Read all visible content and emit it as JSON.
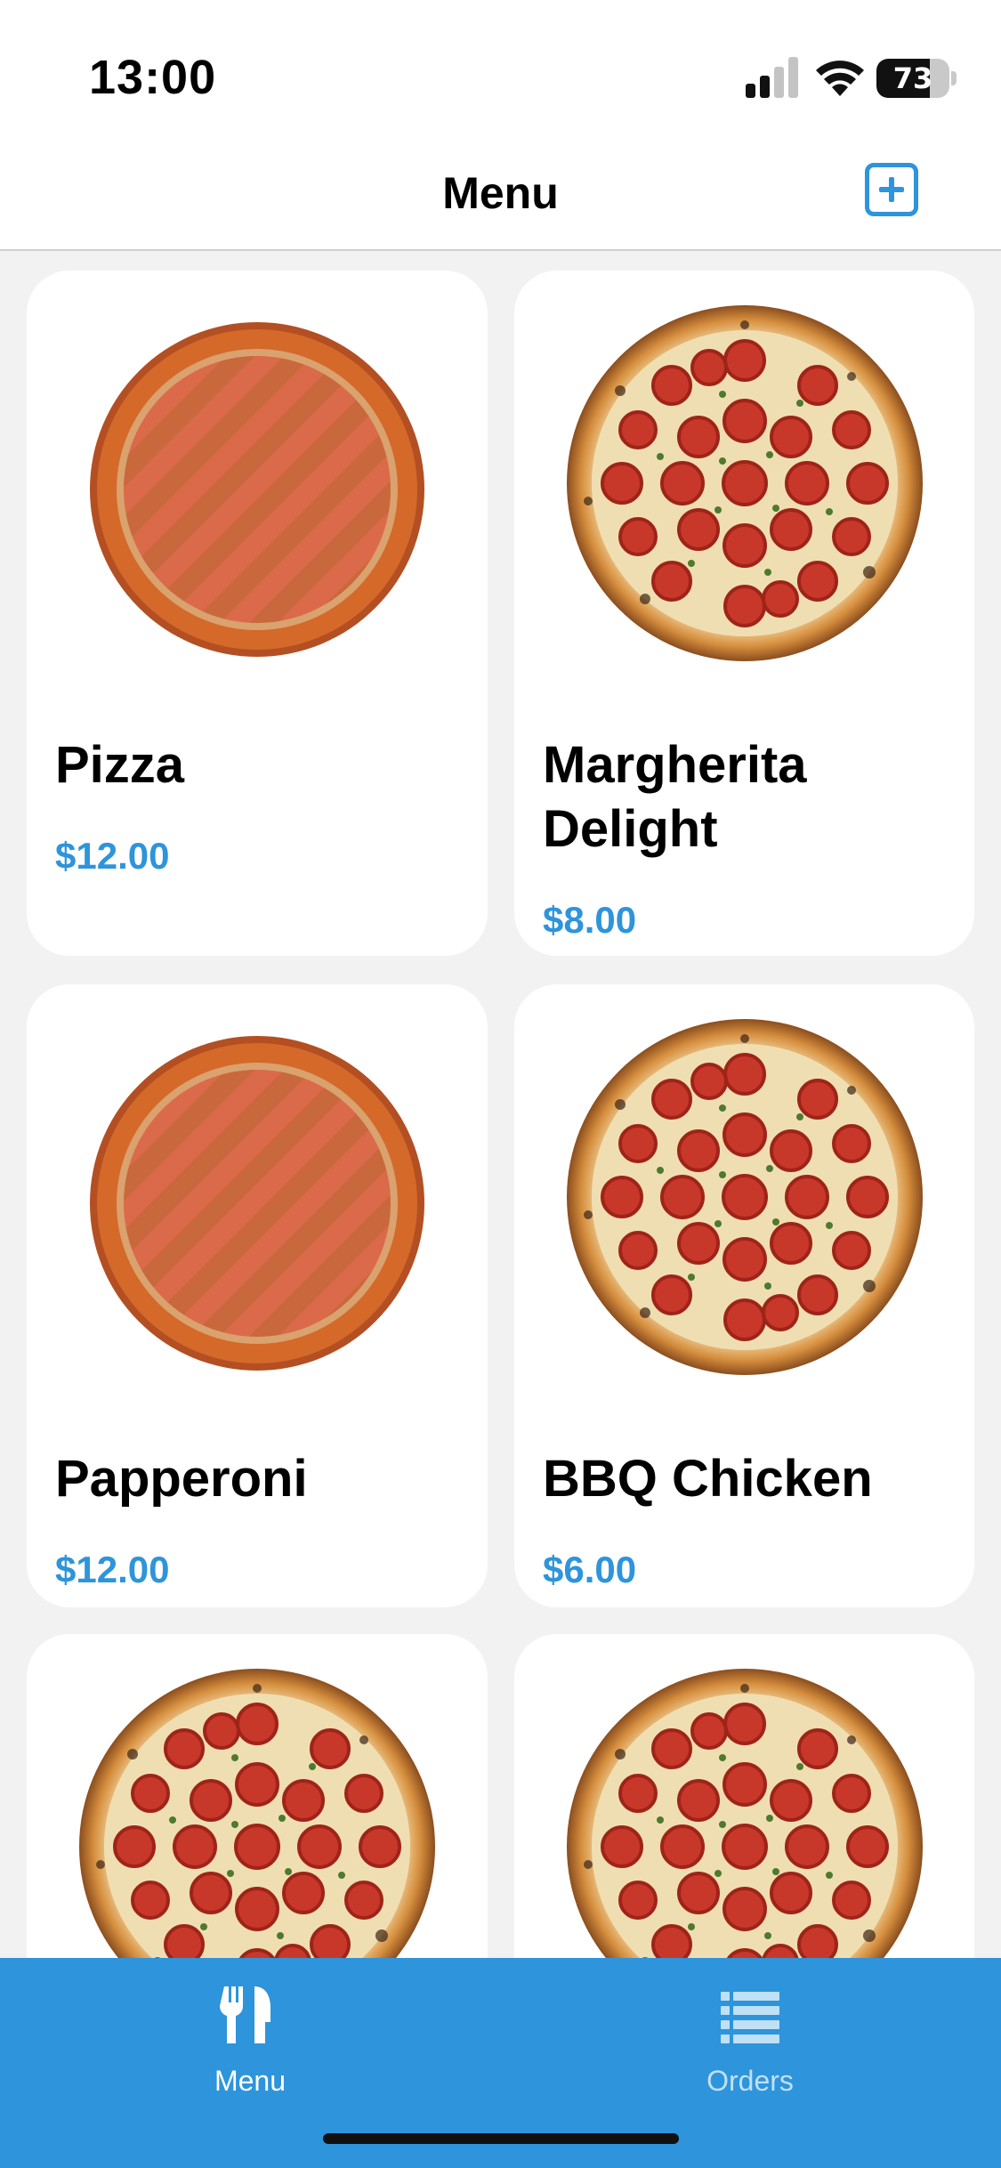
{
  "status_bar": {
    "time": "13:00",
    "battery_level": "73",
    "icons": [
      "cellular-signal-icon",
      "wifi-icon",
      "battery-icon"
    ]
  },
  "nav": {
    "title": "Menu",
    "add_icon": "plus-square-icon"
  },
  "menu_items": [
    {
      "name": "Pizza",
      "price": "$12.00",
      "image": "placeholder-pizza-icon"
    },
    {
      "name": "Margherita Delight",
      "price": "$8.00",
      "image": "pepperoni-pizza-image"
    },
    {
      "name": "Papperoni",
      "price": "$12.00",
      "image": "placeholder-pizza-icon"
    },
    {
      "name": "BBQ Chicken",
      "price": "$6.00",
      "image": "pepperoni-pizza-image"
    },
    {
      "image": "pepperoni-pizza-image"
    },
    {
      "image": "pepperoni-pizza-image"
    }
  ],
  "tab_bar": {
    "tabs": [
      {
        "label": "Menu",
        "icon": "utensils-icon",
        "selected": true
      },
      {
        "label": "Orders",
        "icon": "list-icon",
        "selected": false
      }
    ]
  },
  "colors": {
    "accent": "#2e94db",
    "background": "#f2f2f2",
    "card": "#ffffff",
    "placeholder_orange": "#d4692a",
    "tab_inactive": "#bfe0f5"
  }
}
